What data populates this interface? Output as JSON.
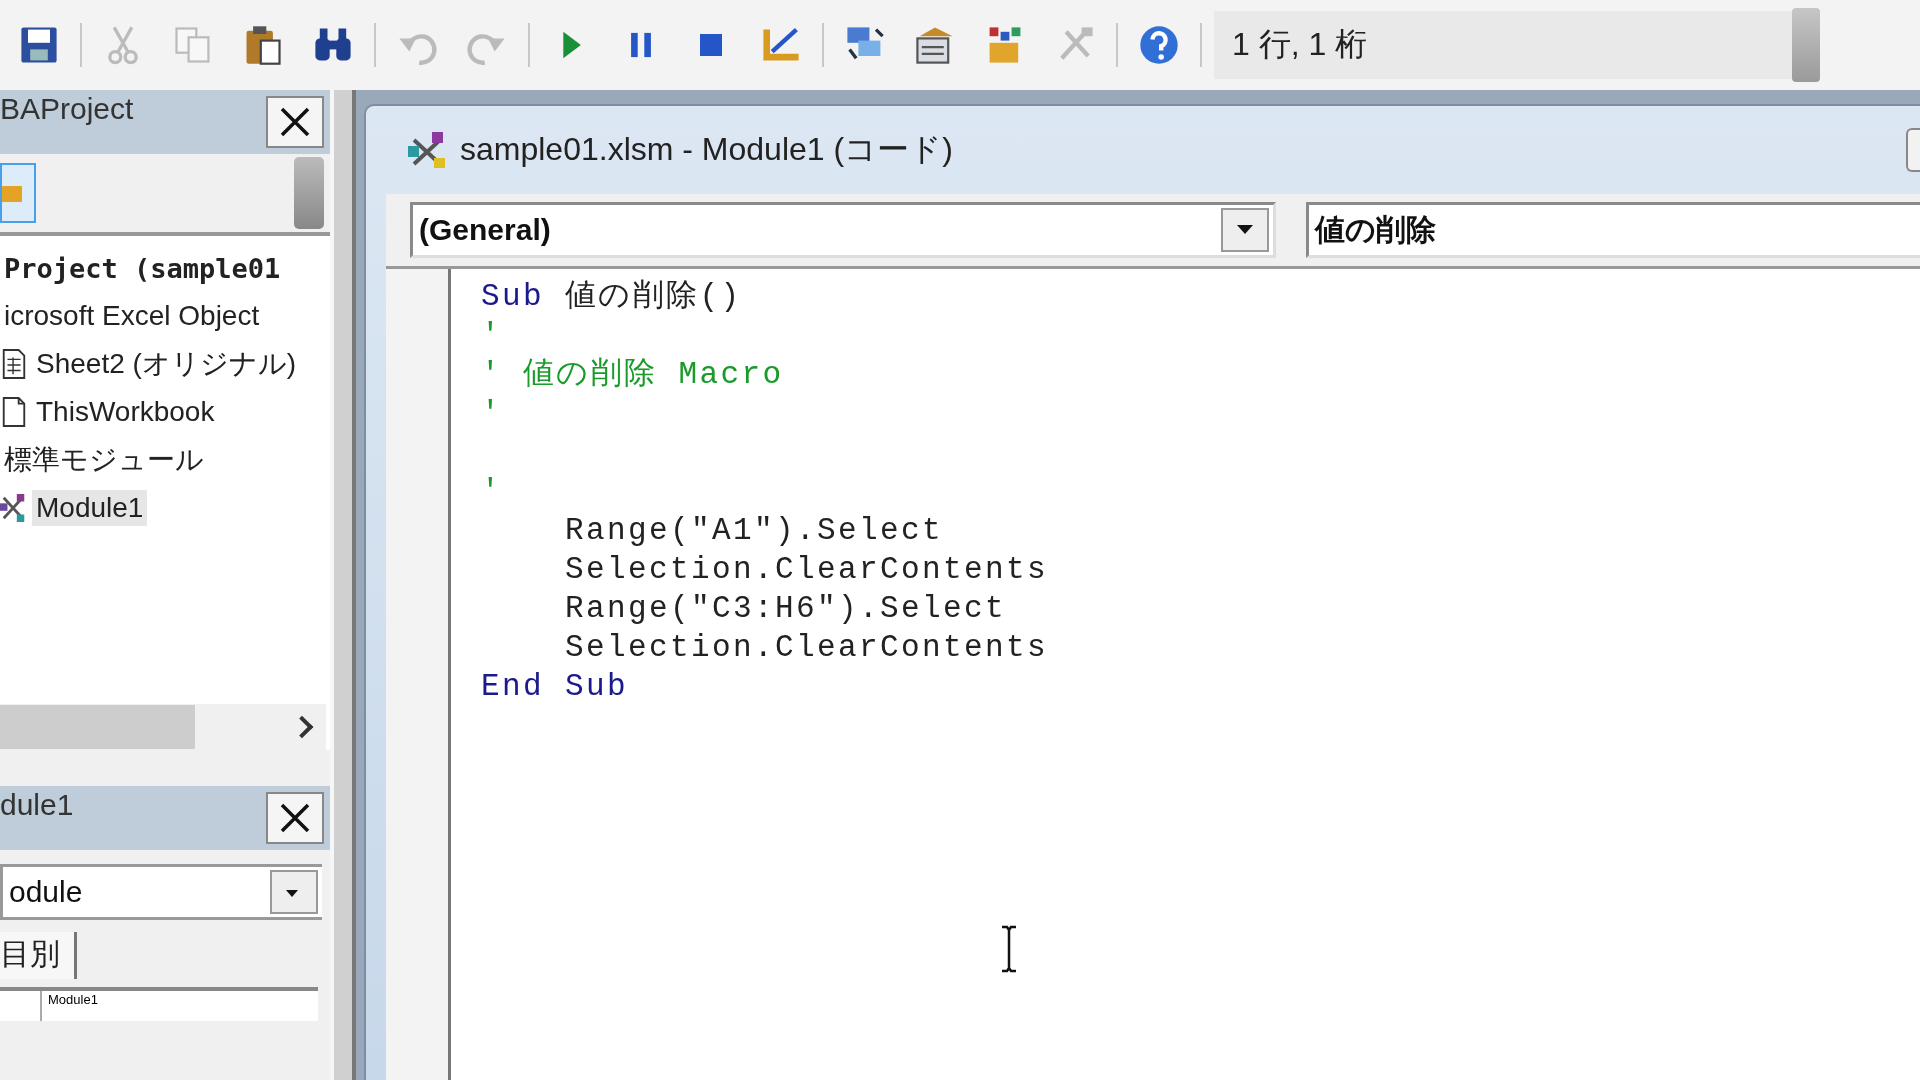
{
  "toolbar": {
    "groups": [
      [
        {
          "kind": "save",
          "disabled": false
        }
      ],
      [
        {
          "kind": "cut",
          "disabled": true
        },
        {
          "kind": "copy",
          "disabled": true
        },
        {
          "kind": "paste",
          "disabled": false
        },
        {
          "kind": "find",
          "disabled": false
        }
      ],
      [
        {
          "kind": "undo",
          "disabled": true
        },
        {
          "kind": "redo",
          "disabled": true
        }
      ],
      [
        {
          "kind": "run",
          "disabled": false
        },
        {
          "kind": "pause",
          "disabled": false
        },
        {
          "kind": "stop",
          "disabled": false
        },
        {
          "kind": "design",
          "disabled": false
        }
      ],
      [
        {
          "kind": "project",
          "disabled": false
        },
        {
          "kind": "properties",
          "disabled": false
        },
        {
          "kind": "browser",
          "disabled": false
        },
        {
          "kind": "toolbox",
          "disabled": true
        }
      ],
      [
        {
          "kind": "help",
          "disabled": false
        }
      ]
    ],
    "position": "1 行, 1 桁"
  },
  "project_explorer": {
    "title": "BAProject",
    "tree": [
      {
        "kind": "project",
        "label": "Project (sample01",
        "selected": false,
        "children": [
          {
            "label": "icrosoft Excel Object",
            "selected": false,
            "children": [
              {
                "kind": "sheet",
                "label": "Sheet2 (オリジナル)",
                "selected": false
              },
              {
                "kind": "workbook",
                "label": "ThisWorkbook",
                "selected": false
              }
            ]
          },
          {
            "label": "標準モジュール",
            "selected": false,
            "children": [
              {
                "kind": "module",
                "label": "Module1",
                "selected": true
              }
            ]
          }
        ]
      }
    ]
  },
  "properties": {
    "title": "dule1",
    "object": "odule",
    "tabs": [
      {
        "label": "目別",
        "selected": true
      }
    ],
    "rows": [
      {
        "value": "Module1"
      }
    ]
  },
  "code_window": {
    "title": "sample01.xlsm - Module1 (コード)",
    "object": "(General)",
    "procedure": "値の削除",
    "lines": [
      {
        "kind": "code",
        "segments": [
          {
            "kind": "keyword",
            "text": "Sub"
          },
          {
            "kind": "plain",
            "text": " 値の削除()"
          }
        ]
      },
      {
        "kind": "code",
        "segments": [
          {
            "kind": "comment",
            "text": "'"
          }
        ]
      },
      {
        "kind": "code",
        "segments": [
          {
            "kind": "comment",
            "text": "' 値の削除 Macro"
          }
        ]
      },
      {
        "kind": "code",
        "segments": [
          {
            "kind": "comment",
            "text": "'"
          }
        ]
      },
      {
        "kind": "blank"
      },
      {
        "kind": "code",
        "segments": [
          {
            "kind": "comment",
            "text": "'"
          }
        ]
      },
      {
        "kind": "code",
        "segments": [
          {
            "kind": "plain",
            "text": "    Range(\"A1\").Select"
          }
        ]
      },
      {
        "kind": "code",
        "segments": [
          {
            "kind": "plain",
            "text": "    Selection.ClearContents"
          }
        ]
      },
      {
        "kind": "code",
        "segments": [
          {
            "kind": "plain",
            "text": "    Range(\"C3:H6\").Select"
          }
        ]
      },
      {
        "kind": "code",
        "segments": [
          {
            "kind": "plain",
            "text": "    Selection.ClearContents"
          }
        ]
      },
      {
        "kind": "code",
        "segments": [
          {
            "kind": "keyword",
            "text": "End Sub"
          }
        ]
      }
    ]
  }
}
